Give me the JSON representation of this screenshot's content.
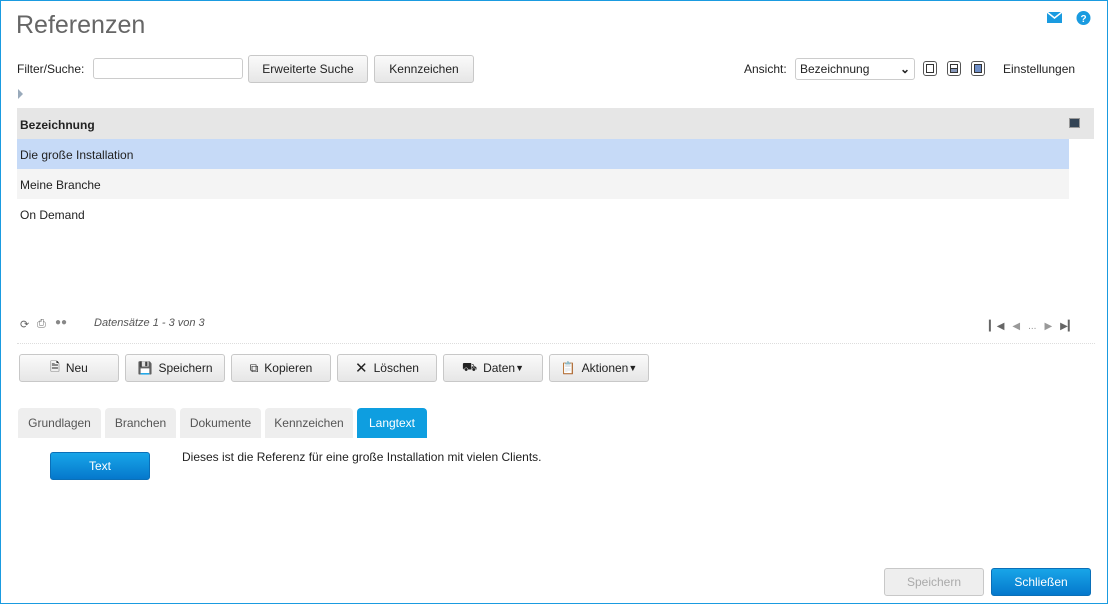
{
  "title": "Referenzen",
  "filter": {
    "label": "Filter/Suche:",
    "value": "",
    "advanced_search": "Erweiterte Suche",
    "tags": "Kennzeichen"
  },
  "view": {
    "label": "Ansicht:",
    "selected": "Bezeichnung",
    "settings": "Einstellungen"
  },
  "grid": {
    "column": "Bezeichnung",
    "rows": [
      "Die große Installation",
      "Meine Branche",
      "On Demand"
    ],
    "selected_index": 0
  },
  "footer": {
    "records": "Datensätze 1 - 3 von 3",
    "ellipsis": "..."
  },
  "toolbar": {
    "new": "Neu",
    "save": "Speichern",
    "copy": "Kopieren",
    "delete": "Löschen",
    "data": "Daten",
    "actions": "Aktionen"
  },
  "tabs": [
    "Grundlagen",
    "Branchen",
    "Dokumente",
    "Kennzeichen",
    "Langtext"
  ],
  "active_tab": "Langtext",
  "langtext": {
    "button": "Text",
    "content": "Dieses ist die Referenz für eine große Installation mit vielen Clients."
  },
  "bottom": {
    "save": "Speichern",
    "close": "Schließen"
  },
  "colors": {
    "accent": "#0e9ee0",
    "selected_row": "#c6daf7"
  }
}
